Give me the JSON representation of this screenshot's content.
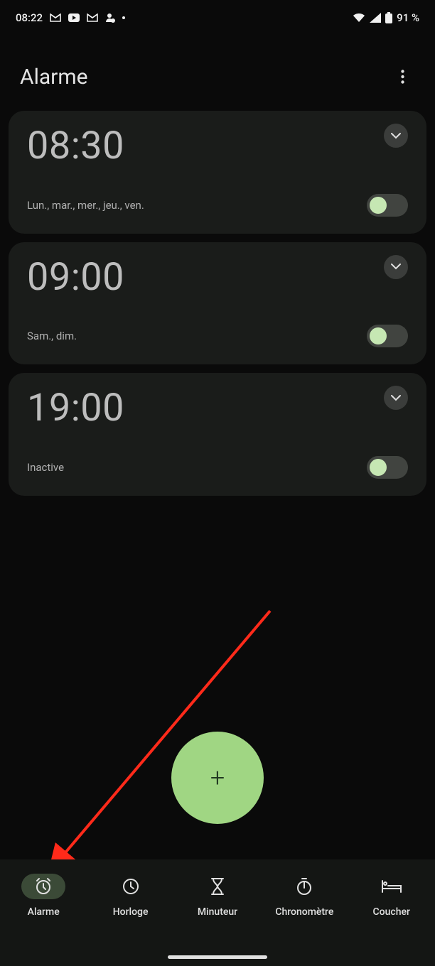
{
  "status": {
    "time": "08:22",
    "battery": "91 %"
  },
  "header": {
    "title": "Alarme"
  },
  "alarms": [
    {
      "time": "08:30",
      "label": "Lun., mar., mer., jeu., ven.",
      "enabled": true
    },
    {
      "time": "09:00",
      "label": "Sam., dim.",
      "enabled": true
    },
    {
      "time": "19:00",
      "label": "Inactive",
      "enabled": false
    }
  ],
  "fab": {
    "glyph": "+"
  },
  "nav": {
    "items": [
      {
        "label": "Alarme",
        "icon": "alarm",
        "active": true
      },
      {
        "label": "Horloge",
        "icon": "clock",
        "active": false
      },
      {
        "label": "Minuteur",
        "icon": "hourglass",
        "active": false
      },
      {
        "label": "Chronomètre",
        "icon": "stopwatch",
        "active": false
      },
      {
        "label": "Coucher",
        "icon": "bed",
        "active": false
      }
    ]
  }
}
